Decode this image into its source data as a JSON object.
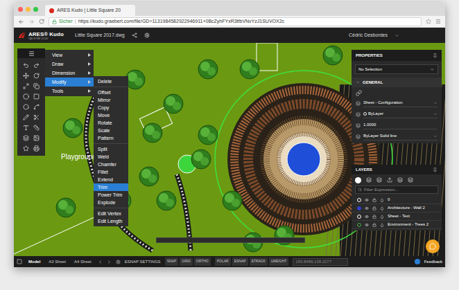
{
  "browser": {
    "tab_title": "ARES Kudo | Little Square 20",
    "secure_label": "Sicher",
    "url": "https://kudo.graebert.com/file/GD=1131984582922946911+0BcZyhFYxR3tfbVNvYzJ1SUVOX2c"
  },
  "app": {
    "logo": "ARES® Kudo",
    "tagline": "CAD IN THE CLOUD",
    "file_name": "Little Square 2017.dwg",
    "user": "Cédric Desbordes"
  },
  "menu": [
    {
      "label": "View",
      "selected": false
    },
    {
      "label": "Draw",
      "selected": false
    },
    {
      "label": "Dimension",
      "selected": false
    },
    {
      "label": "Modify",
      "selected": true
    },
    {
      "label": "Tools",
      "selected": false
    }
  ],
  "submenu": [
    [
      {
        "label": "Delete",
        "selected": false
      }
    ],
    [
      {
        "label": "Offset",
        "selected": false
      },
      {
        "label": "Mirror",
        "selected": false
      },
      {
        "label": "Copy",
        "selected": false
      },
      {
        "label": "Move",
        "selected": false
      },
      {
        "label": "Rotate",
        "selected": false
      },
      {
        "label": "Scale",
        "selected": false
      },
      {
        "label": "Pattern",
        "selected": false
      }
    ],
    [
      {
        "label": "Split",
        "selected": false
      },
      {
        "label": "Weld",
        "selected": false
      },
      {
        "label": "Chamfer",
        "selected": false
      },
      {
        "label": "Fillet",
        "selected": false
      },
      {
        "label": "Extend",
        "selected": false
      },
      {
        "label": "Trim",
        "selected": true
      },
      {
        "label": "Power Trim",
        "selected": false
      },
      {
        "label": "Explode",
        "selected": false
      }
    ],
    [
      {
        "label": "Edit Vertex",
        "selected": false
      },
      {
        "label": "Edit Length",
        "selected": false
      }
    ]
  ],
  "canvas": {
    "labels": [
      "Playground"
    ]
  },
  "properties": {
    "title": "PROPERTIES",
    "selection": "No Selection",
    "section": "GENERAL",
    "rows": [
      "Sheet - Configuration",
      "ByLayer",
      "1.0000",
      "ByLayer Solid line"
    ]
  },
  "layers": {
    "title": "LAYERS",
    "filter_placeholder": "Filter Expression...",
    "rows": [
      {
        "name": "0",
        "color": "#ffffff"
      },
      {
        "name": "Architecture - Wall 2",
        "color": "#2f3fd0"
      },
      {
        "name": "Sheet - Text",
        "color": "#ffffff"
      },
      {
        "name": "Environment - Trees 2",
        "color": "#3fb23f"
      }
    ]
  },
  "status_bar": {
    "tabs": [
      {
        "label": "Model",
        "selected": true
      },
      {
        "label": "A3 Sheet",
        "selected": false
      },
      {
        "label": "A4 Sheet",
        "selected": false
      }
    ],
    "esnap_settings": "ESNAP SETTINGS",
    "toggles_a": [
      "SNAP",
      "GRID",
      "ORTHO"
    ],
    "toggles_b": [
      "POLAR",
      "ESNAP",
      "ETRACK",
      "LWEIGHT"
    ],
    "coordinates": "183.8489,138.2277",
    "feedback": "Feedback"
  }
}
